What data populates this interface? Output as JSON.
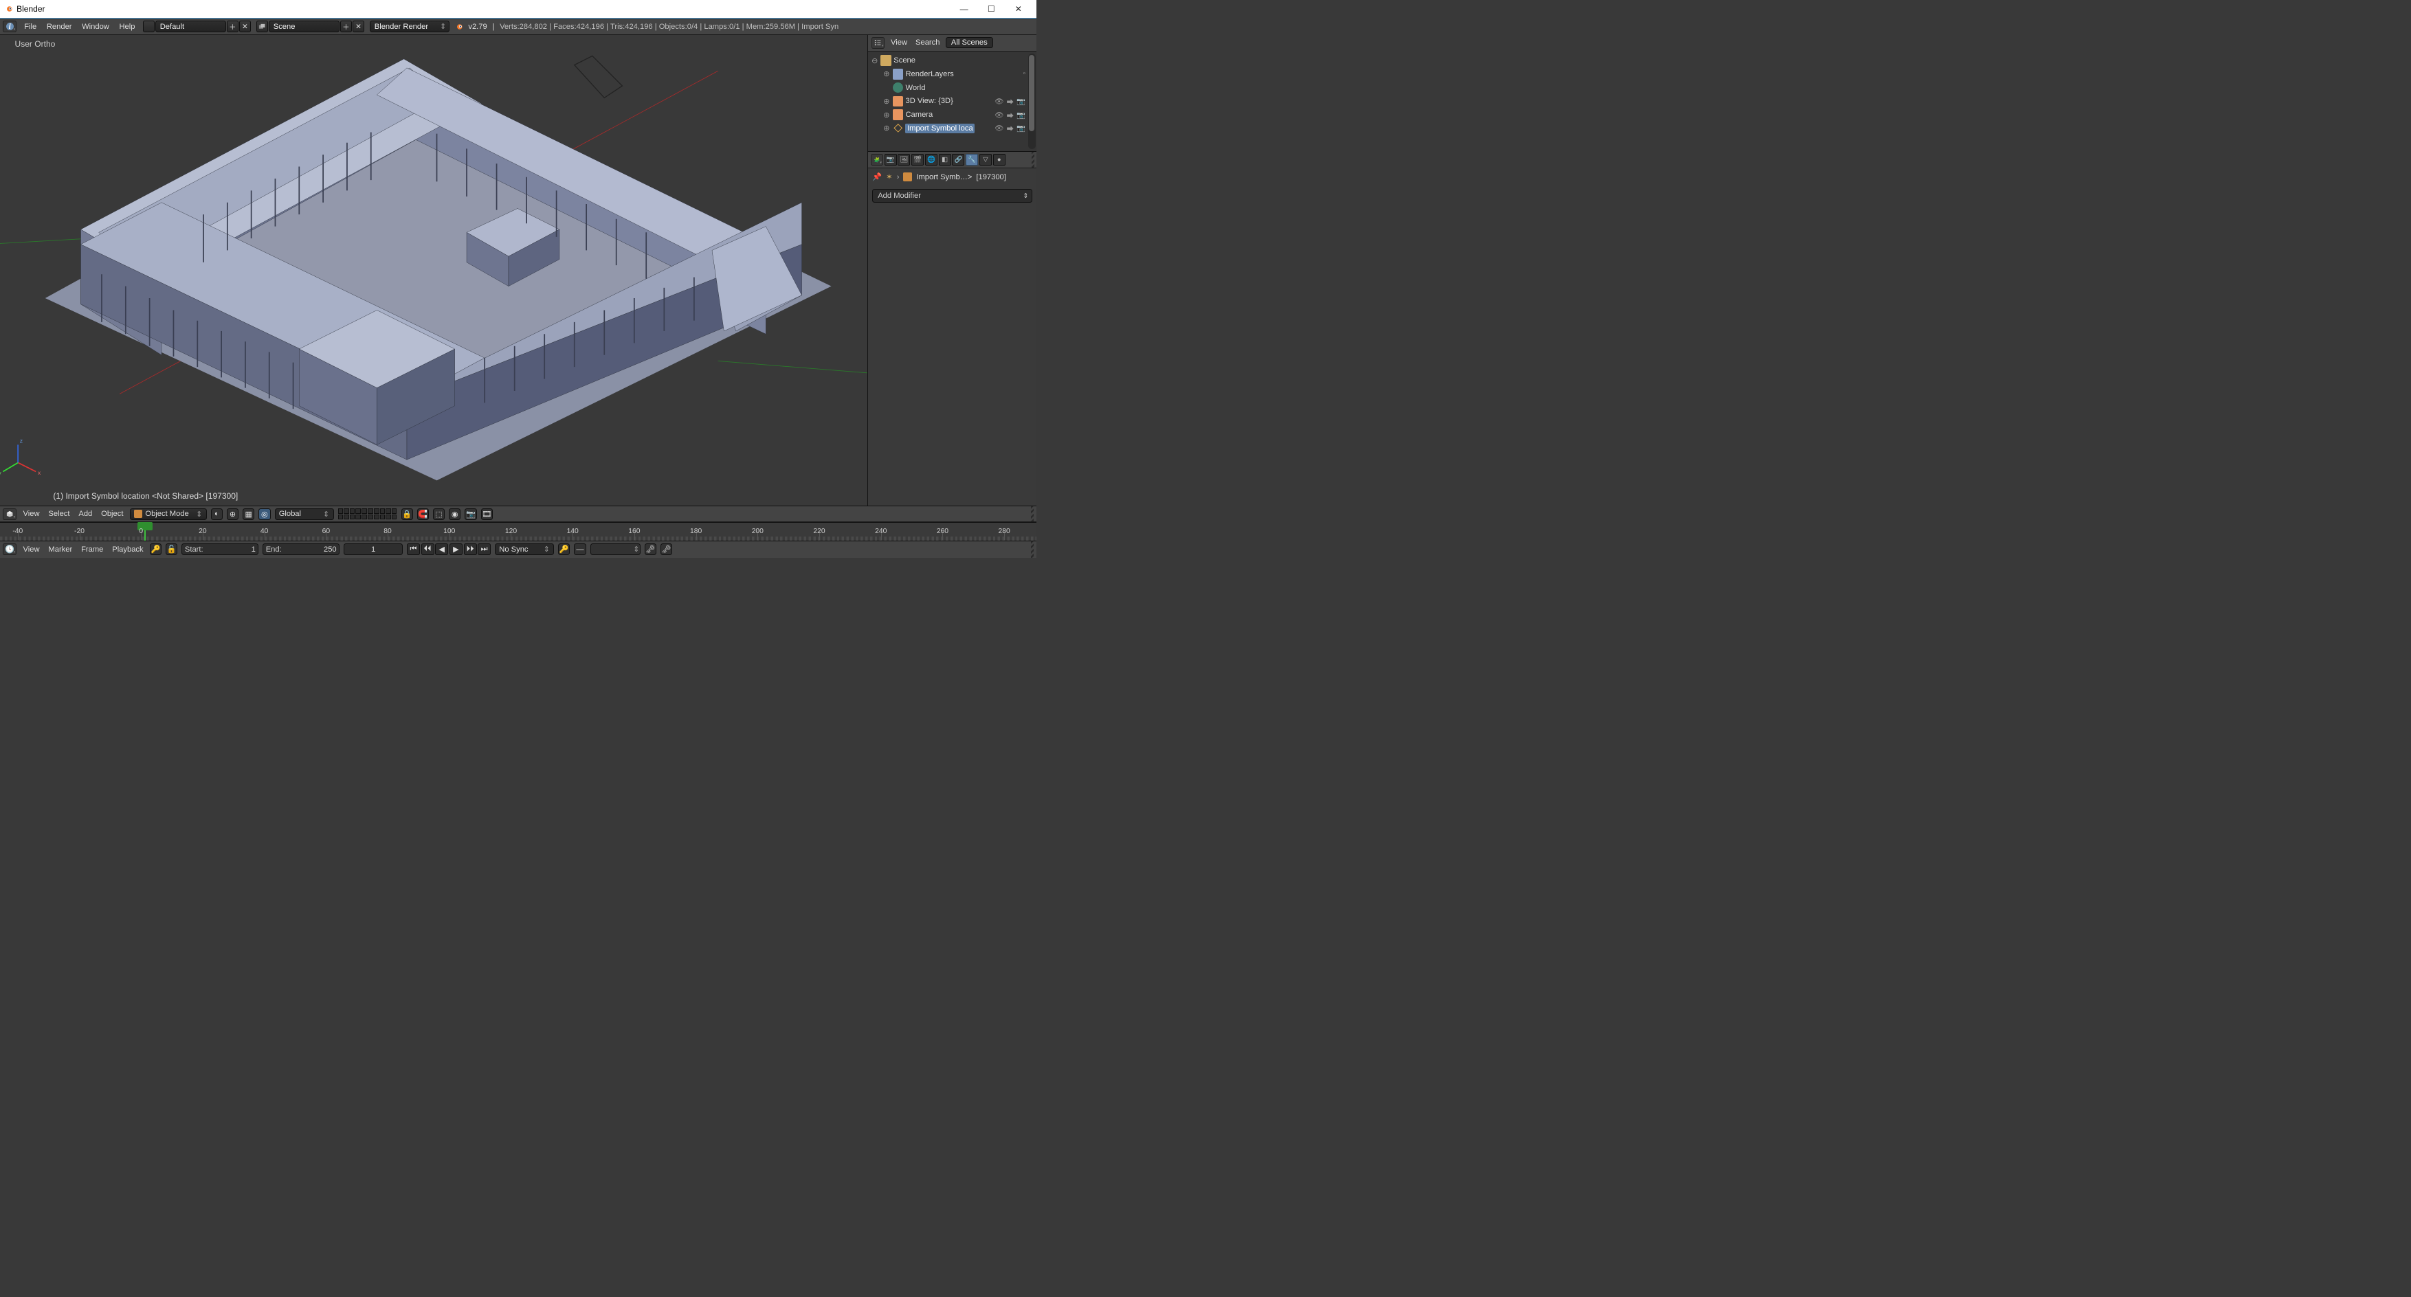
{
  "window": {
    "title": "Blender"
  },
  "header": {
    "menus": [
      "File",
      "Render",
      "Window",
      "Help"
    ],
    "layout_selector": "Default",
    "scene_selector": "Scene",
    "engine_selector": "Blender Render",
    "version": "v2.79",
    "status": "Verts:284,802 | Faces:424,196 | Tris:424,196 | Objects:0/4 | Lamps:0/1 | Mem:259.56M | Import Syn"
  },
  "viewport": {
    "view_label": "User Ortho",
    "object_label": "(1) Import Symbol location <Not Shared> [197300]",
    "menus": [
      "View",
      "Select",
      "Add",
      "Object"
    ],
    "mode": "Object Mode",
    "orientation": "Global"
  },
  "outliner": {
    "menu_view": "View",
    "menu_search": "Search",
    "filter": "All Scenes",
    "items": {
      "scene": "Scene",
      "renderlayers": "RenderLayers",
      "world": "World",
      "view3d": "3D View: {3D}",
      "camera": "Camera",
      "import": "Import Symbol loca"
    }
  },
  "properties": {
    "breadcrumb_obj": "Import Symb…>",
    "breadcrumb_id": "[197300]",
    "add_modifier": "Add Modifier"
  },
  "timeline": {
    "menus": [
      "View",
      "Marker",
      "Frame",
      "Playback"
    ],
    "start_label": "Start:",
    "start_value": "1",
    "end_label": "End:",
    "end_value": "250",
    "current_value": "1",
    "sync": "No Sync",
    "ticks": [
      -40,
      -20,
      0,
      20,
      40,
      60,
      80,
      100,
      120,
      140,
      160,
      180,
      200,
      220,
      240,
      260,
      280
    ]
  }
}
